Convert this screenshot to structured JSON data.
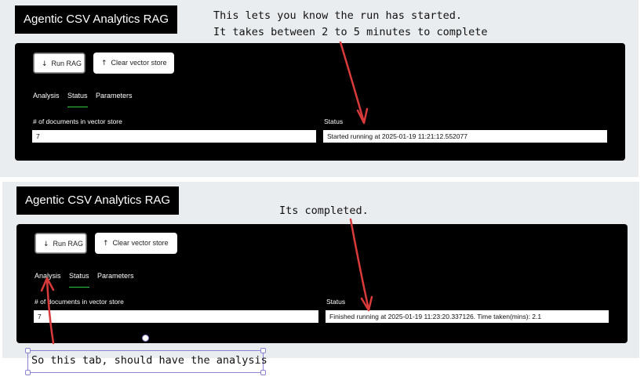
{
  "top": {
    "app_title": "Agentic CSV Analytics RAG",
    "buttons": {
      "run_icon": "↓",
      "run_label": "Run RAG",
      "clear_icon": "↑",
      "clear_label": "Clear vector store"
    },
    "tabs": [
      "Analysis",
      "Status",
      "Parameters"
    ],
    "active_tab": "Status",
    "docs_label": "# of documents in vector store",
    "docs_value": "7",
    "status_label": "Status",
    "status_value": "Started running at 2025-01-19 11:21:12.552077"
  },
  "bottom": {
    "app_title": "Agentic CSV Analytics RAG",
    "buttons": {
      "run_icon": "↓",
      "run_label": "Run RAG",
      "clear_icon": "↑",
      "clear_label": "Clear vector store"
    },
    "tabs": [
      "Analysis",
      "Status",
      "Parameters"
    ],
    "active_tab": "Status",
    "docs_label": "# of documents in vector store",
    "docs_value": "7",
    "status_label": "Status",
    "status_value": "Finished running at 2025-01-19 11:23:20.337126. Time taken(mins): 2.1"
  },
  "annotations": {
    "note1_line1": "This lets you know the run has started.",
    "note1_line2": "It takes between 2 to 5 minutes to complete",
    "note2": "Its completed.",
    "note3": "So this tab, should have the analysis",
    "arrow_color": "#d93a3a"
  },
  "colors": {
    "background": "#e9edf0",
    "panel": "#000000",
    "tab_active_underline": "#2ecc40",
    "selection": "#8a82d6"
  }
}
